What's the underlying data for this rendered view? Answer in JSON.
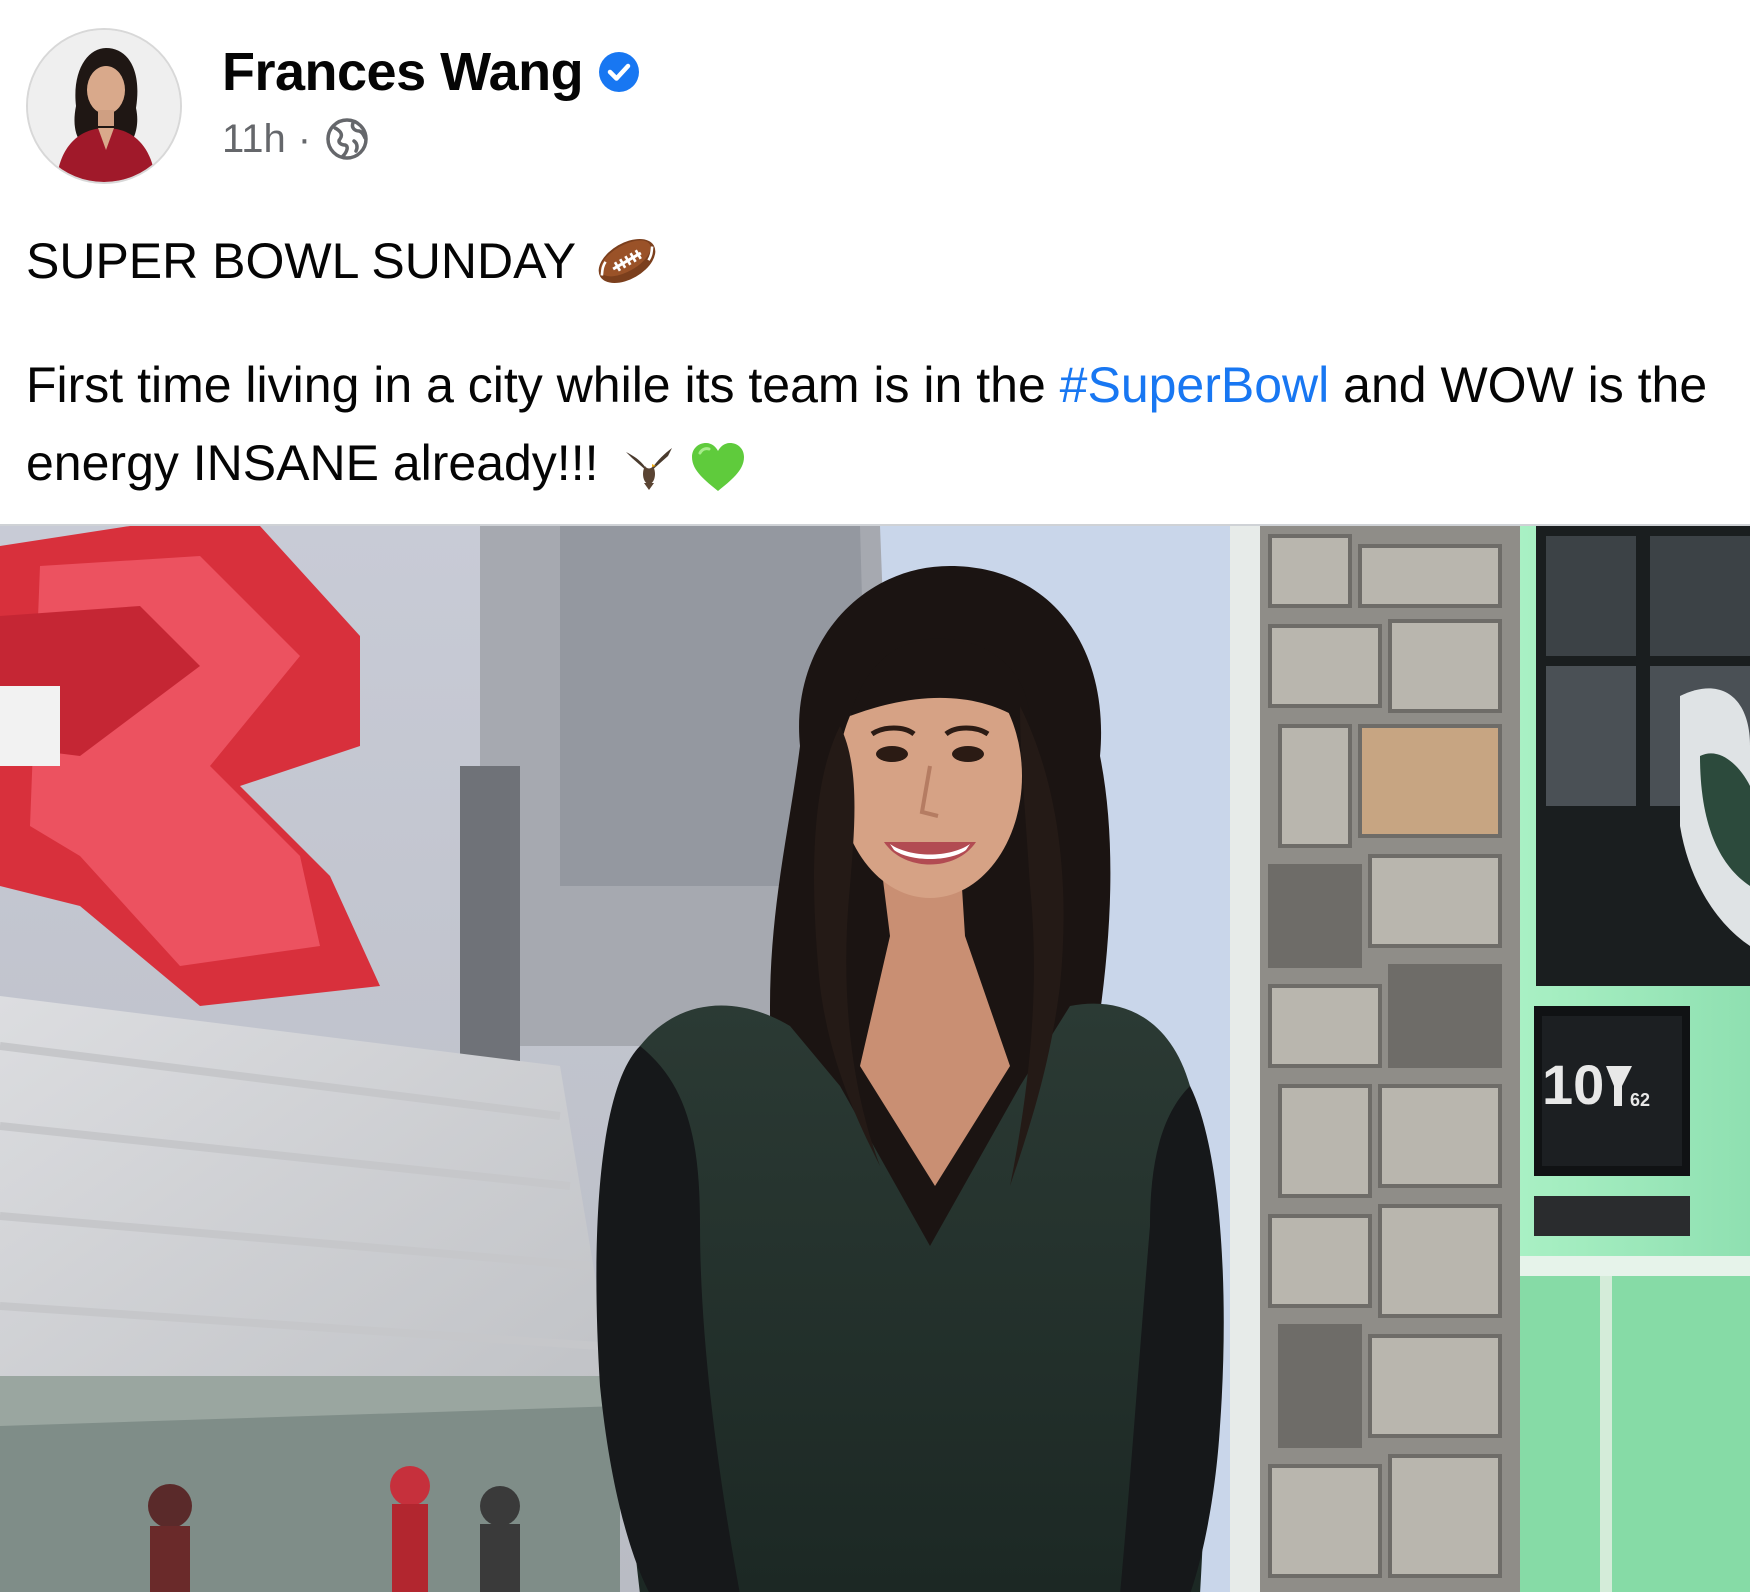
{
  "post": {
    "author": "Frances Wang",
    "verified": true,
    "time": "11h",
    "separator": "·",
    "audience_icon": "globe-icon",
    "title_line": "SUPER BOWL SUNDAY",
    "title_emoji": "american-football-emoji",
    "body_part1": "First time living in a city while its team is in the ",
    "hashtag": "#SuperBowl",
    "body_part2": "  and WOW is the energy INSANE already!!!",
    "body_emojis": [
      "eagle-emoji",
      "green-heart-emoji"
    ]
  },
  "photo": {
    "tv_channel_number": "10",
    "tv_sub_number": "62"
  },
  "colors": {
    "link": "#1877f2",
    "verified_badge": "#1877f2",
    "meta_text": "#65676b",
    "text": "#050505"
  }
}
